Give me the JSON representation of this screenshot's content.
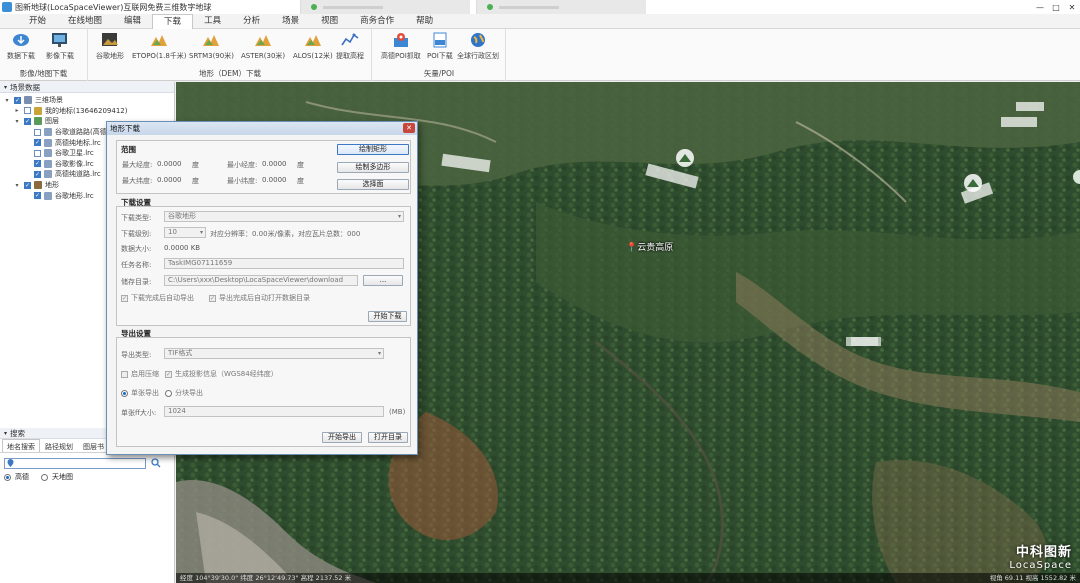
{
  "window": {
    "title": "图新地球(LocaSpaceViewer)互联网免费三维数字地球",
    "controls": [
      "—",
      "□",
      "✕"
    ]
  },
  "menu": [
    "开始",
    "在线地图",
    "编辑",
    "下载",
    "工具",
    "分析",
    "场景",
    "视图",
    "商务合作",
    "帮助"
  ],
  "menu_active": "下载",
  "ribbon": {
    "groups": [
      {
        "label": "影像/地图下载",
        "buttons": [
          "数据下载",
          "影像下载"
        ]
      },
      {
        "label": "地形（DEM）下载",
        "buttons": [
          "谷歌地形",
          "ETOPO(1.8千米)",
          "SRTM3(90米)",
          "ASTER(30米)",
          "ALOS(12米)",
          "提取高程"
        ]
      },
      {
        "label": "矢量/POI",
        "buttons": [
          "高德POI抓取",
          "POI下载",
          "全球行政区划"
        ]
      }
    ]
  },
  "scene_panel": {
    "header": "场景数据",
    "tree": [
      {
        "label": "三维场景",
        "level": 0,
        "expand": "▾",
        "checked": true,
        "icon": "globe-icon",
        "color": "#7a8fb0"
      },
      {
        "label": "我的地标(13646209412)",
        "level": 1,
        "expand": "▸",
        "checked": false,
        "icon": "pin-icon",
        "color": "#c9a43a"
      },
      {
        "label": "图层",
        "level": 1,
        "expand": "▾",
        "checked": true,
        "icon": "layers-icon",
        "color": "#5b9a5b"
      },
      {
        "label": "谷歌道路路(高德)",
        "level": 2,
        "expand": "",
        "checked": false,
        "icon": "layer-icon",
        "color": "#8aa0c0"
      },
      {
        "label": "高德纯地标.lrc",
        "level": 2,
        "expand": "",
        "checked": true,
        "icon": "layer-icon",
        "color": "#8aa0c0"
      },
      {
        "label": "谷歌卫星.lrc",
        "level": 2,
        "expand": "",
        "checked": false,
        "icon": "layer-icon",
        "color": "#8aa0c0"
      },
      {
        "label": "谷歌影像.lrc",
        "level": 2,
        "expand": "",
        "checked": true,
        "icon": "layer-icon",
        "color": "#8aa0c0"
      },
      {
        "label": "高德纯道路.lrc",
        "level": 2,
        "expand": "",
        "checked": true,
        "icon": "layer-icon",
        "color": "#8aa0c0"
      },
      {
        "label": "地形",
        "level": 1,
        "expand": "▾",
        "checked": true,
        "icon": "terrain-icon",
        "color": "#8b6a3e"
      },
      {
        "label": "谷歌地形.lrc",
        "level": 2,
        "expand": "",
        "checked": true,
        "icon": "layer-icon",
        "color": "#8aa0c0"
      }
    ]
  },
  "search_panel": {
    "header": "搜索",
    "tabs": [
      "地名搜索",
      "路径规划",
      "图层书"
    ],
    "query": "",
    "sources": [
      "高德",
      "天地图"
    ],
    "selected_source": "高德"
  },
  "map": {
    "placemark": "云贵高原",
    "status_left": "经度 104°39'30.0\"  纬度 26°12'49.73\"  高程 2137.52 米",
    "status_right": "视角 69.11  视高 1552.82 米",
    "brand_cn": "中科图新",
    "brand_en": "LocaSpace"
  },
  "dialog": {
    "title": "地形下载",
    "range": {
      "section": "范围",
      "max_lon_label": "最大经度:",
      "max_lon": "0.0000",
      "unit": "度",
      "min_lon_label": "最小经度:",
      "min_lon": "0.0000",
      "max_lat_label": "最大纬度:",
      "max_lat": "0.0000",
      "min_lat_label": "最小纬度:",
      "min_lat": "0.0000",
      "buttons": [
        "绘制矩形",
        "绘制多边形",
        "选择面"
      ]
    },
    "download": {
      "section": "下载设置",
      "type_label": "下载类型:",
      "type_value": "谷歌地形",
      "level_label": "下载级别:",
      "level_value": "10",
      "level_info": "对应分辨率：0.00米/像素，对应瓦片总数：000",
      "size_label": "数据大小:",
      "size_value": "0.0000 KB",
      "task_label": "任务名称:",
      "task_value": "TaskIMG07111659",
      "dir_label": "储存目录:",
      "dir_value": "C:\\Users\\xxx\\Desktop\\LocaSpaceViewer\\download",
      "browse": "...",
      "auto_export": "下载完成后自动导出",
      "auto_open": "导出完成后自动打开数据目录",
      "start": "开始下载"
    },
    "export": {
      "section": "导出设置",
      "type_label": "导出类型:",
      "type_value": "TIF格式",
      "compress": "启用压缩",
      "georef": "生成投影信息（WGS84经纬度）",
      "single": "单张导出",
      "tiled": "分块导出",
      "max_size_label": "单张ff大小:",
      "max_size_value": "1024",
      "max_size_unit": "(MB)",
      "start": "开始导出",
      "open_dir": "打开目录"
    }
  }
}
